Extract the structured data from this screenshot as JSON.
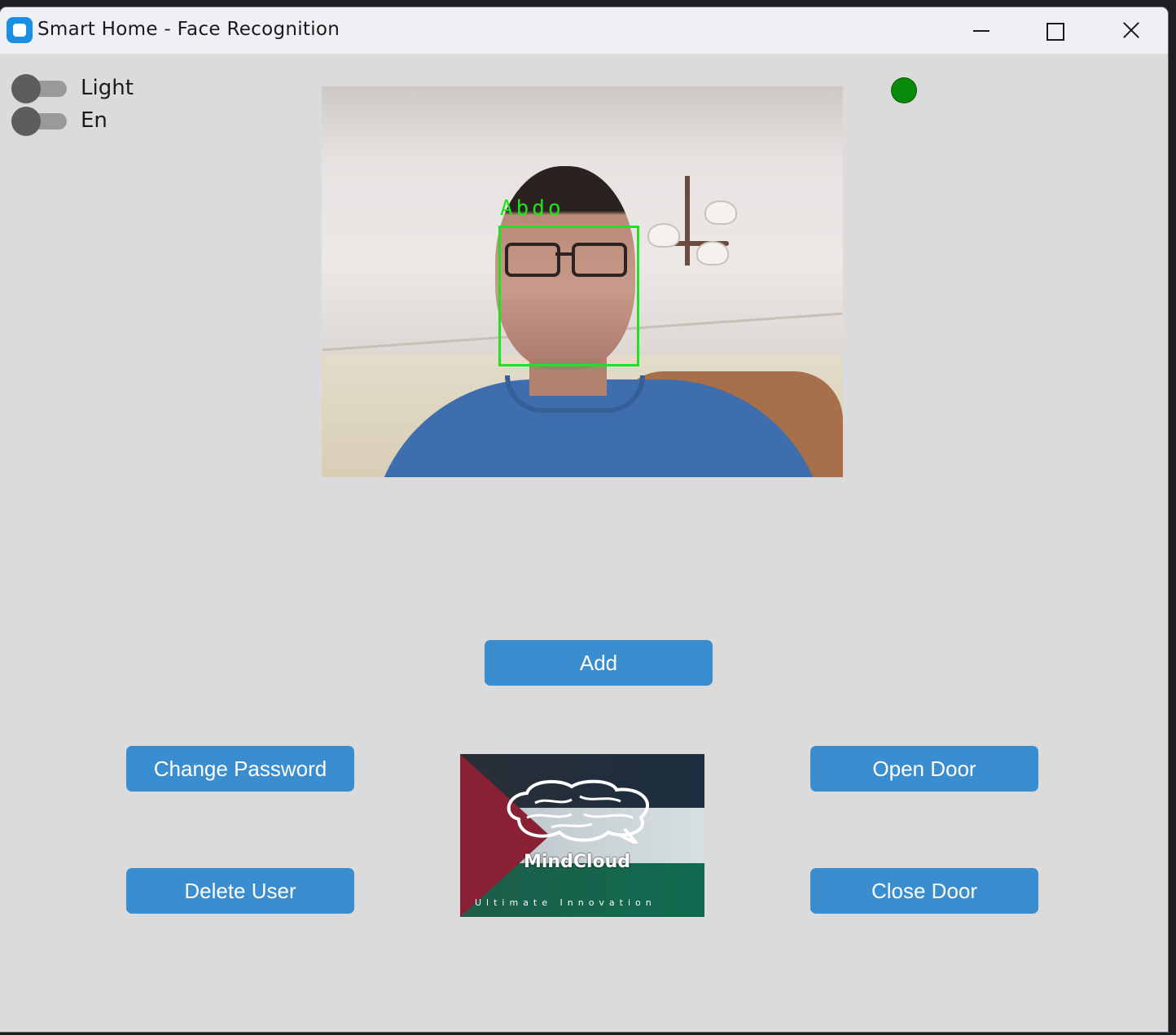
{
  "window": {
    "title": "Smart Home - Face Recognition",
    "icon": "app-icon"
  },
  "switches": [
    {
      "label": "Light",
      "state": "off"
    },
    {
      "label": "En",
      "state": "off"
    }
  ],
  "camera": {
    "detected_name": "Abdo"
  },
  "status_indicator": {
    "color": "#0a8a0a"
  },
  "buttons": {
    "add": "Add",
    "change_password": "Change Password",
    "delete_user": "Delete User",
    "open_door": "Open Door",
    "close_door": "Close Door"
  },
  "logo": {
    "name": "MindCloud",
    "tagline": "Ultimate Innovation"
  },
  "colors": {
    "accent": "#3a8dcf",
    "window_bg": "#dbdbdb",
    "detection": "#1de51d"
  }
}
